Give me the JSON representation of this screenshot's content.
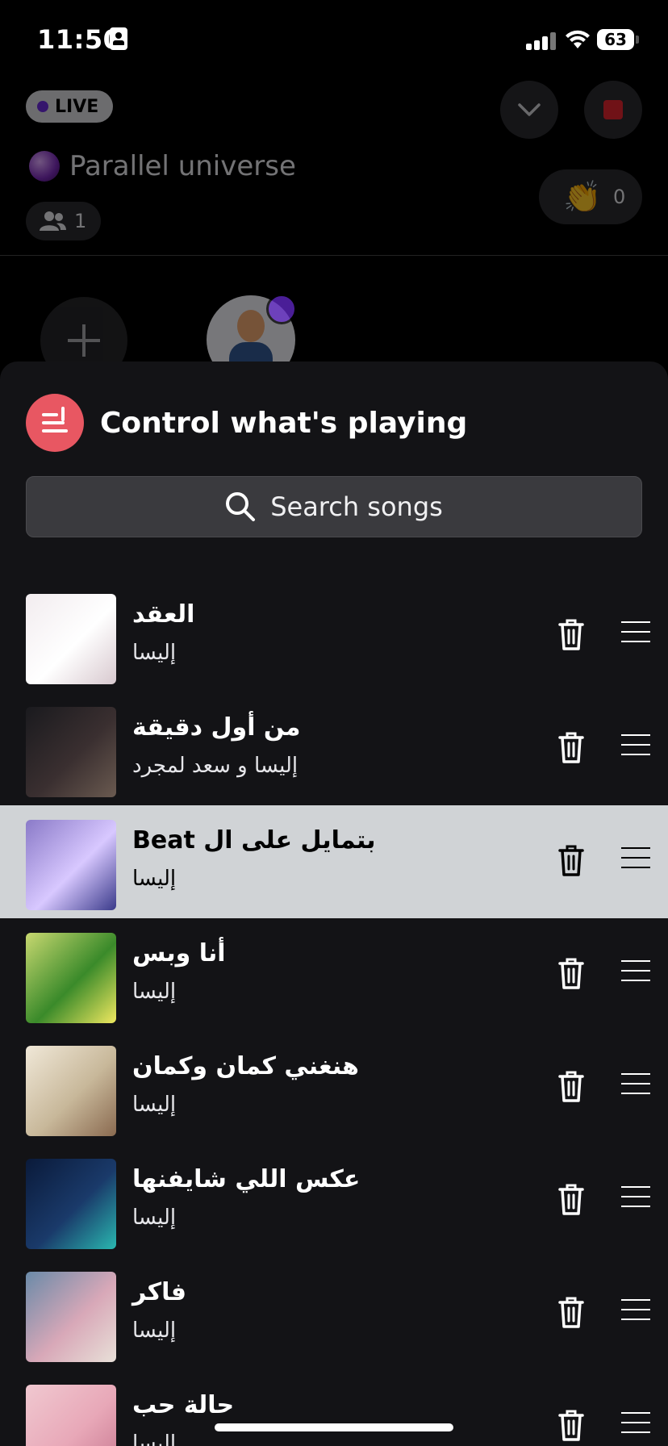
{
  "status_bar": {
    "time": "11:50",
    "battery": "63"
  },
  "live": {
    "badge": "LIVE",
    "room_title": "Parallel universe",
    "listeners": "1",
    "claps": "0"
  },
  "sheet": {
    "title": "Control what's playing",
    "search_placeholder": "Search songs",
    "accent": "#e85762"
  },
  "songs": [
    {
      "title": "العقد",
      "artist": "إليسا",
      "art_colors": [
        "#f2ecef",
        "#ffffff",
        "#d8c9cf"
      ]
    },
    {
      "title": "من أول دقيقة",
      "artist": "إليسا و سعد لمجرد",
      "art_colors": [
        "#1a1a1e",
        "#3a2f30",
        "#6a5a50"
      ]
    },
    {
      "title": "بتمايل على ال Beat",
      "artist": "إليسا",
      "art_colors": [
        "#8a7ac8",
        "#d8c8ff",
        "#3a3a8a"
      ]
    },
    {
      "title": "أنا وبس",
      "artist": "إليسا",
      "art_colors": [
        "#c8d870",
        "#3a8a2a",
        "#f0e860"
      ]
    },
    {
      "title": "هنغني كمان وكمان",
      "artist": "إليسا",
      "art_colors": [
        "#f0e8d8",
        "#c8b89a",
        "#8a6a50"
      ]
    },
    {
      "title": "عكس اللي شايفنها",
      "artist": "إليسا",
      "art_colors": [
        "#0a1a3a",
        "#1a3a6a",
        "#2ab8b0"
      ]
    },
    {
      "title": "فاكر",
      "artist": "إليسا",
      "art_colors": [
        "#6a8aa8",
        "#d8a8b8",
        "#e8e0d8"
      ]
    },
    {
      "title": "حالة حب",
      "artist": "إليسا",
      "art_colors": [
        "#f0c8d0",
        "#e8a8b8",
        "#c87890"
      ]
    }
  ]
}
